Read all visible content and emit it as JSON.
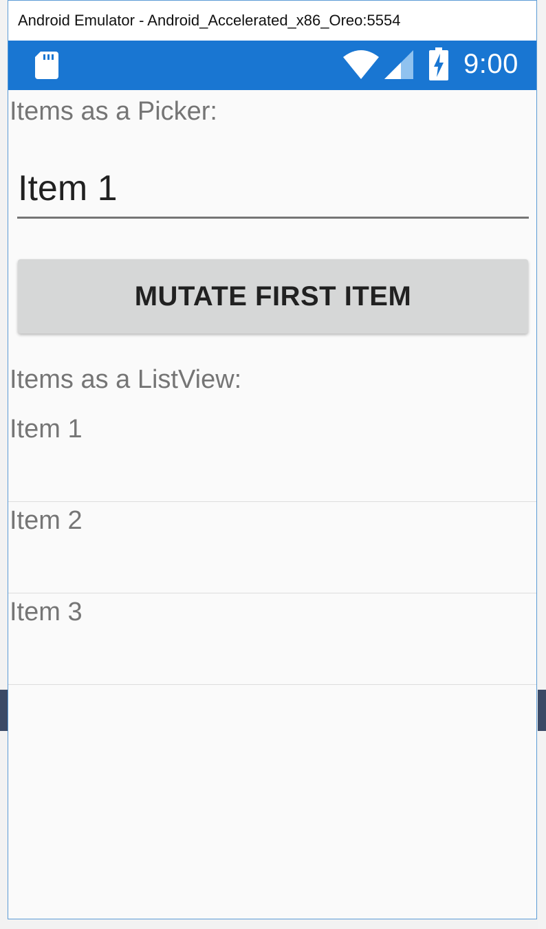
{
  "window": {
    "title": "Android Emulator - Android_Accelerated_x86_Oreo:5554"
  },
  "status_bar": {
    "time": "9:00",
    "color": "#1976d2",
    "icons": [
      "sd-card-icon",
      "wifi-icon",
      "signal-icon",
      "battery-charging-icon"
    ]
  },
  "picker_section": {
    "label": "Items as a Picker:",
    "selected_value": "Item 1"
  },
  "mutate_button": {
    "label": "MUTATE FIRST ITEM"
  },
  "listview_section": {
    "label": "Items as a ListView:",
    "items": [
      "Item 1",
      "Item 2",
      "Item 3"
    ]
  }
}
